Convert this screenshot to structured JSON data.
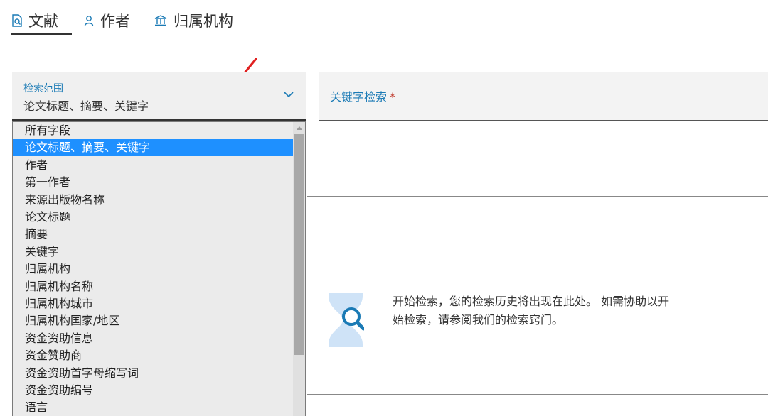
{
  "tabs": [
    {
      "label": "文献",
      "icon": "document-search-icon",
      "active": true
    },
    {
      "label": "作者",
      "icon": "person-icon",
      "active": false
    },
    {
      "label": "归属机构",
      "icon": "institution-icon",
      "active": false
    }
  ],
  "scope": {
    "label": "检索范围",
    "value": "论文标题、摘要、关键字"
  },
  "keyword": {
    "label": "关键字检索",
    "required_mark": "*"
  },
  "dropdown": {
    "selected_index": 1,
    "options": [
      "所有字段",
      "论文标题、摘要、关键字",
      "作者",
      "第一作者",
      "来源出版物名称",
      "论文标题",
      "摘要",
      "关键字",
      "归属机构",
      "归属机构名称",
      "归属机构城市",
      "归属机构国家/地区",
      "资金资助信息",
      "资金赞助商",
      "资金资助首字母缩写词",
      "资金资助编号",
      "语言"
    ]
  },
  "empty_state": {
    "text_line1": "开始检索，您的检索历史将出现在此处。 如需协助以开",
    "text_line2_prefix": "始检索，请参阅我们的",
    "link": "检索窍门",
    "text_line2_suffix": "。"
  },
  "colors": {
    "accent": "#1a7ab5",
    "selected": "#1e90ff",
    "annotation": "#e02020",
    "required": "#c0392b"
  }
}
